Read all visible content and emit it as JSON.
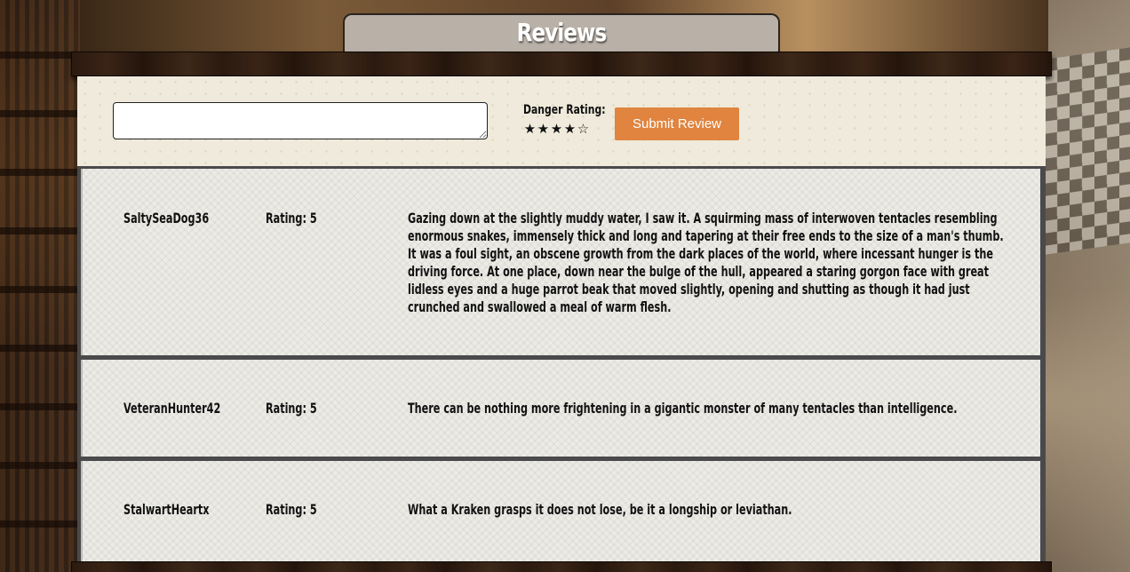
{
  "header": {
    "title": "Reviews"
  },
  "compose": {
    "input_value": "",
    "input_placeholder": "",
    "danger_label": "Danger Rating:",
    "rating_selected": 4,
    "rating_max": 5,
    "submit_label": "Submit Review"
  },
  "reviews": [
    {
      "user": "SaltySeaDog36",
      "rating": "Rating: 5",
      "text": "Gazing down at the slightly muddy water, I saw it. A squirming mass of interwoven tentacles resembling enormous snakes, immensely thick and long and tapering at their free ends to the size of a man's thumb. It was a foul sight, an obscene growth from the dark places of the world, where incessant hunger is the driving force. At one place, down near the bulge of the hull, appeared a staring gorgon face with great lidless eyes and a huge parrot beak that moved slightly, opening and shutting as though it had just crunched and swallowed a meal of warm flesh."
    },
    {
      "user": "VeteranHunter42",
      "rating": "Rating: 5",
      "text": "There can be nothing more frightening in a gigantic monster of many tentacles than intelligence."
    },
    {
      "user": "StalwartHeartx",
      "rating": "Rating: 5",
      "text": "What a Kraken grasps it does not lose, be it a longship or leviathan."
    }
  ],
  "colors": {
    "submit_button": "#e0843f",
    "tab": "#b9b1a8",
    "parchment": "#efeadb",
    "card": "#ecebe6"
  }
}
